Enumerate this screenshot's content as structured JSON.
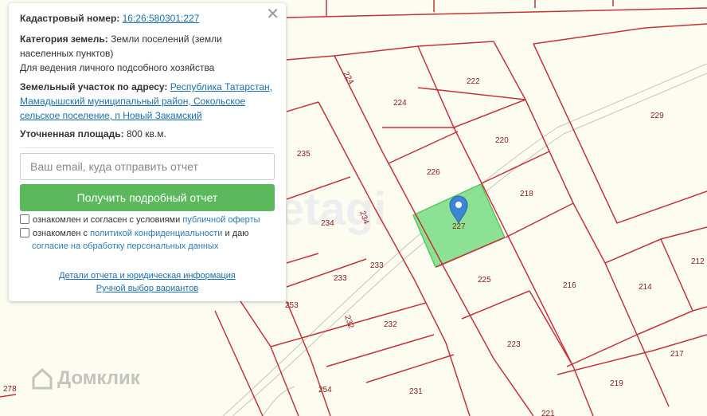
{
  "map": {
    "highlight_plot": "227",
    "highlight_color": "#7fe08a",
    "marker_color": "#3c86d6",
    "line_color": "#c4333a",
    "watermark": "etagi",
    "brand": "Домклик",
    "plots": {
      "p224a": "224",
      "p224b": "224",
      "p222": "222",
      "p220": "220",
      "p226": "226",
      "p229": "229",
      "p235": "235",
      "p218": "218",
      "p227": "227",
      "p234a": "234",
      "p234b": "234",
      "p212": "212",
      "p233a": "233",
      "p233b": "233",
      "p225": "225",
      "p216": "216",
      "p214": "214",
      "p253": "253",
      "p232a": "232",
      "p232b": "232",
      "p223": "223",
      "p217": "217",
      "p219": "219",
      "p254": "254",
      "p231": "231",
      "p278": "278",
      "p221": "221"
    }
  },
  "card": {
    "cadastral_label": "Кадастровый номер:",
    "cadastral_number": "16:26:580301:227",
    "category_label": "Категория земель:",
    "category_value": "Земли поселений (земли населенных пунктов)",
    "usage": "Для ведения личного подсобного хозяйства",
    "address_label": "Земельный участок по адресу:",
    "address_value": "Республика Татарстан, Мамадышский муниципальный район, Сокольское сельское поселение, п Новый Закамский",
    "area_label": "Уточненная площадь:",
    "area_value": "800 кв.м.",
    "email_placeholder": "Ваш email, куда отправить отчет",
    "cta_label": "Получить подробный отчет",
    "consent1_text": "ознакомлен и согласен с условиями",
    "consent1_link": "публичной оферты",
    "consent2_text": "ознакомлен с",
    "consent2_link": "политикой конфиденциальности",
    "consent2_suffix": "и даю",
    "consent2_link2": "согласие на обработку персональных данных",
    "details_link": "Детали отчета и юридическая информация",
    "manual_link": "Ручной выбор вариантов",
    "close_symbol": "✕"
  }
}
